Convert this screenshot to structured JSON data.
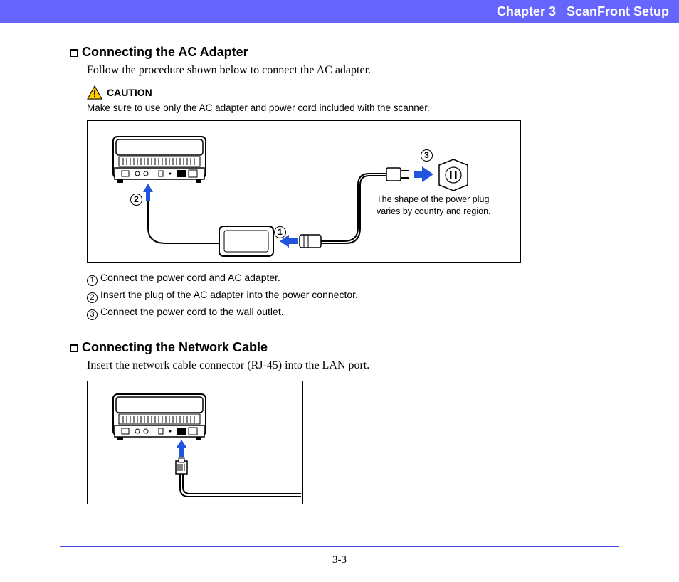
{
  "header": {
    "chapter": "Chapter 3",
    "title": "ScanFront Setup"
  },
  "section1": {
    "heading": "Connecting the AC Adapter",
    "intro": "Follow the procedure shown below to connect the AC adapter.",
    "caution_label": "CAUTION",
    "caution_text": "Make sure to use only the AC adapter and power cord included with the scanner.",
    "figure_note": "The shape of the power plug varies by country and region.",
    "callouts": {
      "c1": "1",
      "c2": "2",
      "c3": "3"
    },
    "steps": [
      {
        "num": "1",
        "text": "Connect the power cord and AC adapter."
      },
      {
        "num": "2",
        "text": "Insert the plug of the AC adapter into the power connector."
      },
      {
        "num": "3",
        "text": "Connect the power cord to the wall outlet."
      }
    ]
  },
  "section2": {
    "heading": "Connecting the Network Cable",
    "intro": "Insert the network cable connector (RJ-45) into the LAN port."
  },
  "footer": {
    "page": "3-3"
  }
}
